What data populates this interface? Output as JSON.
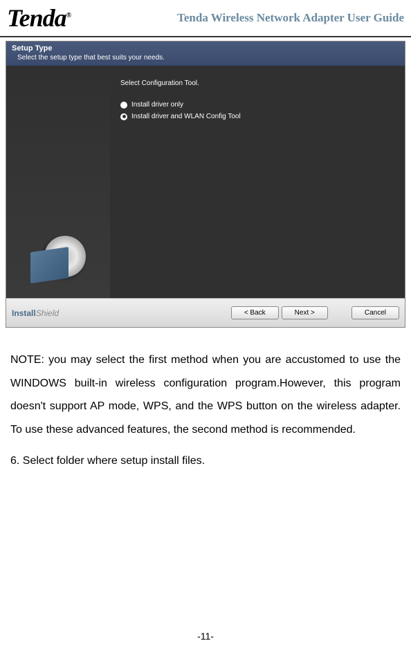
{
  "header": {
    "logo_text": "Tenda",
    "logo_r": "®",
    "title": "Tenda Wireless Network Adapter User Guide"
  },
  "installer": {
    "title": "Setup Type",
    "subtitle": "Select the setup type that best suits your needs.",
    "config_label": "Select Configuration Tool.",
    "option1": "Install driver only",
    "option2": "Install driver and WLAN Config Tool",
    "brand_bold": "Install",
    "brand_light": "Shield",
    "back_button": "< Back",
    "next_button": "Next >",
    "cancel_button": "Cancel"
  },
  "note_text": "NOTE: you may select the first method when you are accustomed to use the WINDOWS built-in wireless configuration program.However, this program doesn't  support AP mode, WPS, and the WPS button on the wireless adapter. To use these advanced features, the second method is recommended.",
  "step_text": "6. Select  folder where setup install files.",
  "page_number": "-11-"
}
